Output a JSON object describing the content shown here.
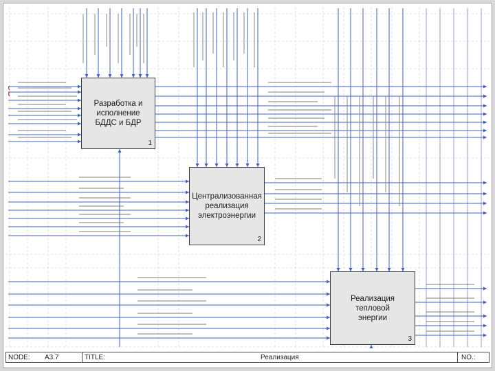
{
  "activities": [
    {
      "title": "Разработка и\nисполнение\nБДДС и БДР",
      "number": "1"
    },
    {
      "title": "Централизованная\nреализация\nэлектроэнергии",
      "number": "2"
    },
    {
      "title": "Реализация\nтепловой\nэнергии",
      "number": "3"
    }
  ],
  "footer": {
    "node_label": "NODE:",
    "node_value": "А3.7",
    "title_label": "TITLE:",
    "title_value": "Реализация",
    "no_label": "NO.:"
  },
  "colors": {
    "arrow": "#3f5fbf",
    "tunnel": "#c0392b",
    "box_fill": "#e6e6e6",
    "grid": "#c8c8c8"
  }
}
